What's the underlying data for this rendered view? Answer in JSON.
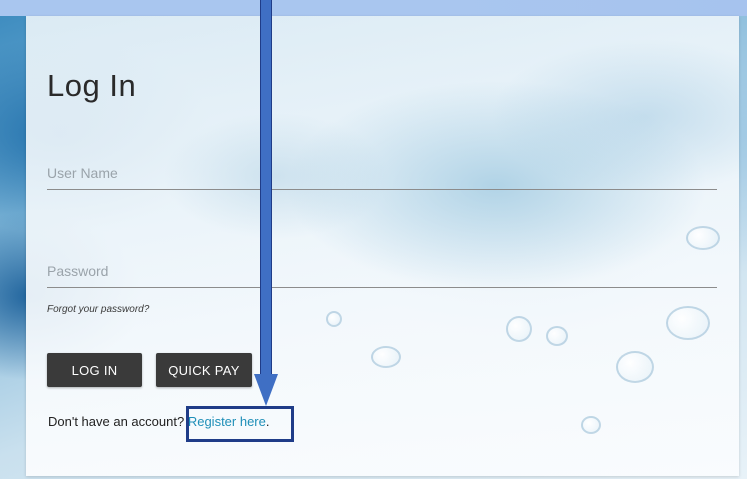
{
  "page": {
    "title": "Log In"
  },
  "form": {
    "username_placeholder": "User Name",
    "password_placeholder": "Password",
    "forgot_label": "Forgot your password?",
    "login_label": "LOG IN",
    "quickpay_label": "QUICK PAY",
    "register_prompt": "Don't have an account?",
    "register_link": "Register here",
    "register_suffix": "."
  },
  "annotation": {
    "arrow_color": "#3f6fc4",
    "box_color": "#1f3c88"
  },
  "colors": {
    "button_bg": "#3a3a3a",
    "link": "#1f8fb8"
  }
}
